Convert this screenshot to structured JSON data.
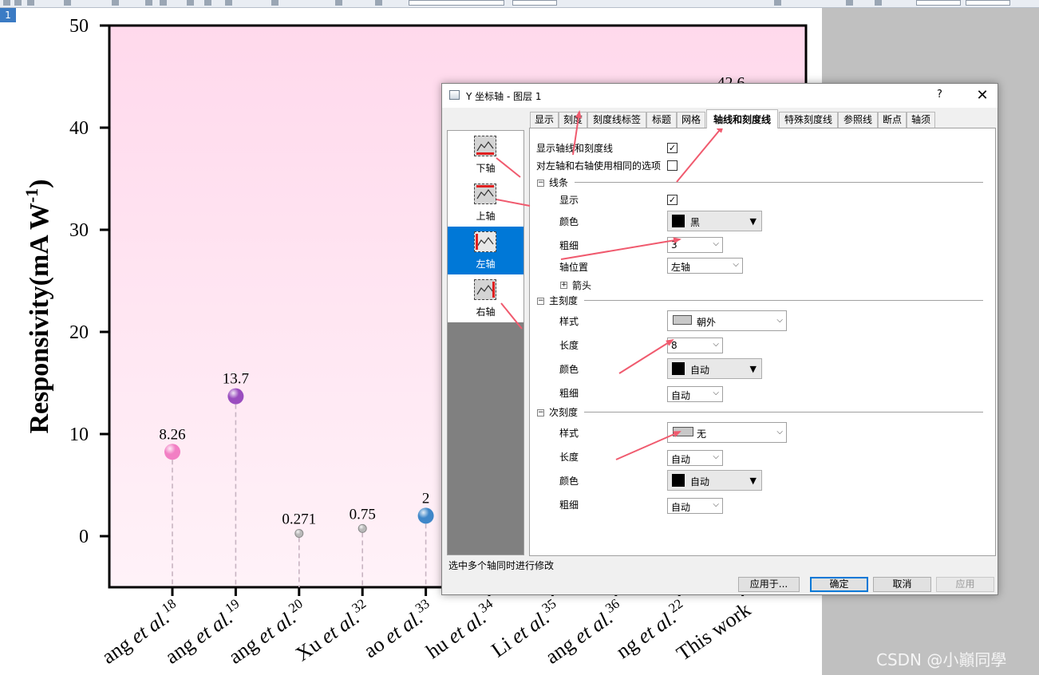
{
  "app": {
    "layer_tag": "1",
    "canvas_bg": "#c0c0c0"
  },
  "chart_data": {
    "type": "scatter",
    "style": "lollipop / drop-line points with value labels",
    "ylabel_main": "Responsivity(mA W",
    "ylabel_sup": "-1",
    "ylabel_close": ")",
    "ylim": [
      -5,
      50
    ],
    "yticks": [
      0,
      10,
      20,
      30,
      40,
      50
    ],
    "background": "#ffe0ef",
    "categories": [
      {
        "text": "ang et al.",
        "sup": "18"
      },
      {
        "text": "ang et al.",
        "sup": "19"
      },
      {
        "text": "ang et al.",
        "sup": "20"
      },
      {
        "text": "Xu et al.",
        "sup": "32"
      },
      {
        "text": "ao et al.",
        "sup": "33"
      },
      {
        "text": "hu et al.",
        "sup": "34"
      },
      {
        "text": "Li et al.",
        "sup": "35"
      },
      {
        "text": "ang et al.",
        "sup": "36"
      },
      {
        "text": "ng et al.",
        "sup": "22"
      },
      {
        "text": "This work",
        "sup": ""
      }
    ],
    "points": [
      {
        "value": 8.26,
        "label": "8.26",
        "color": "#f27fc4"
      },
      {
        "value": 13.7,
        "label": "13.7",
        "color": "#9a4dbf"
      },
      {
        "value": 0.271,
        "label": "0.271",
        "color": "#b9b9b9"
      },
      {
        "value": 0.75,
        "label": "0.75",
        "color": "#b9b9b9"
      },
      {
        "value": 2,
        "label": "2",
        "color": "#3f87c9"
      }
    ],
    "partial_label": "42.6"
  },
  "dialog": {
    "title": "Y 坐标轴 - 图层 1",
    "help": "?",
    "close": "✕",
    "tabs": [
      "显示",
      "刻度",
      "刻度线标签",
      "标题",
      "网格",
      "轴线和刻度线",
      "特殊刻度线",
      "参照线",
      "断点",
      "轴须"
    ],
    "active_tab": "轴线和刻度线",
    "axes": [
      {
        "label": "下轴",
        "highlight": "bottom"
      },
      {
        "label": "上轴",
        "highlight": "top"
      },
      {
        "label": "左轴",
        "highlight": "left",
        "selected": true
      },
      {
        "label": "右轴",
        "highlight": "right"
      }
    ],
    "opts": {
      "show_axis_ticks": "显示轴线和刻度线",
      "same_options": "对左轴和右轴使用相同的选项"
    },
    "line": {
      "section": "线条",
      "show": "显示",
      "color": "颜色",
      "color_value": "黑",
      "width": "粗细",
      "width_value": "3",
      "position": "轴位置",
      "position_value": "左轴",
      "arrow": "箭头"
    },
    "major": {
      "section": "主刻度",
      "style": "样式",
      "style_value": "朝外",
      "length": "长度",
      "length_value": "8",
      "color": "颜色",
      "color_value": "自动",
      "width": "粗细",
      "width_value": "自动"
    },
    "minor": {
      "section": "次刻度",
      "style": "样式",
      "style_value": "无",
      "length": "长度",
      "length_value": "自动",
      "color": "颜色",
      "color_value": "自动",
      "width": "粗细",
      "width_value": "自动"
    },
    "status": "选中多个轴同时进行修改",
    "buttons": {
      "apply_to": "应用于...",
      "ok": "确定",
      "cancel": "取消",
      "apply": "应用"
    }
  },
  "watermark": "CSDN @小巓同學",
  "accent_color": "#0078d7",
  "annotation_color": "#f05a6e"
}
